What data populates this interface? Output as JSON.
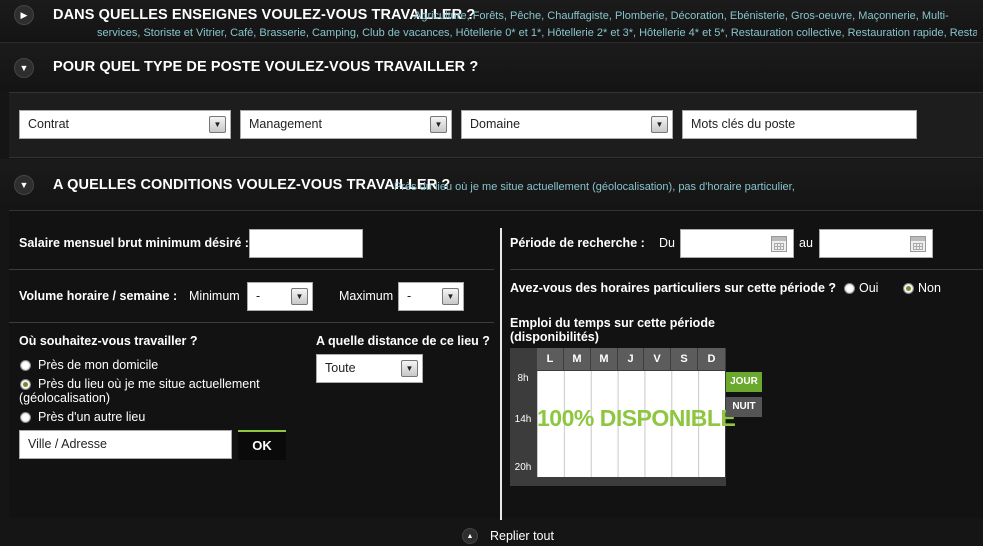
{
  "sections": {
    "enseignes": {
      "title": "DANS QUELLES ENSEIGNES VOULEZ-VOUS TRAVAILLER ?",
      "summary_line1": "Agriculture, Forêts, Pêche, Chauffagiste, Plomberie, Décoration, Ebénisterie, Gros-oeuvre, Maçonnerie, Multi-",
      "summary_line2": "services, Storiste et Vitrier, Café, Brasserie, Camping, Club de vacances, Hôtellerie 0* et 1*, Hôtellerie 2* et 3*, Hôtellerie 4* et 5*, Restauration collective, Restauration rapide, Restauration"
    },
    "poste": {
      "title": "POUR QUEL TYPE DE POSTE VOULEZ-VOUS TRAVAILLER ?",
      "contrat": "Contrat",
      "management": "Management",
      "domaine": "Domaine",
      "keywords_value": "Mots clés du poste"
    },
    "conditions": {
      "title": "A QUELLES CONDITIONS VOULEZ-VOUS TRAVAILLER ?",
      "summary": "Près du lieu où je me situe actuellement (géolocalisation), pas d'horaire particulier,"
    }
  },
  "conditions": {
    "salary_label": "Salaire mensuel brut minimum désiré :",
    "salary_value": "",
    "volume_label": "Volume horaire / semaine :",
    "minimum_label": "Minimum",
    "minimum_value": "-",
    "maximum_label": "Maximum",
    "maximum_value": "-",
    "where_label": "Où souhaitez-vous travailler ?",
    "where_options": [
      {
        "label": "Près de mon domicile",
        "selected": false
      },
      {
        "label": "Près du lieu où je me situe actuellement",
        "label2": "(géolocalisation)",
        "selected": true
      },
      {
        "label": "Près d'un autre lieu",
        "selected": false
      }
    ],
    "address_value": "Ville / Adresse",
    "ok_label": "OK",
    "distance_label": "A quelle distance de ce lieu ?",
    "distance_value": "Toute",
    "period_label": "Période de recherche :",
    "du_label": "Du",
    "au_label": "au",
    "du_value": "",
    "au_value": "",
    "horaires_question": "Avez-vous des horaires particuliers sur cette période ?",
    "oui_label": "Oui",
    "non_label": "Non",
    "horaires_selected": "Non",
    "schedule_title_line1": "Emploi du temps sur cette période",
    "schedule_title_line2": "(disponibilités)",
    "days": [
      "L",
      "M",
      "M",
      "J",
      "V",
      "S",
      "D"
    ],
    "hours": [
      "8h",
      "14h",
      "20h"
    ],
    "availability_text": "100% DISPONIBLE",
    "jour_label": "JOUR",
    "nuit_label": "NUIT"
  },
  "footer": {
    "collapse_all": "Replier tout"
  },
  "colors": {
    "accent_green": "#8dc63f",
    "summary_teal": "#88c4cc",
    "background": "#151515"
  }
}
